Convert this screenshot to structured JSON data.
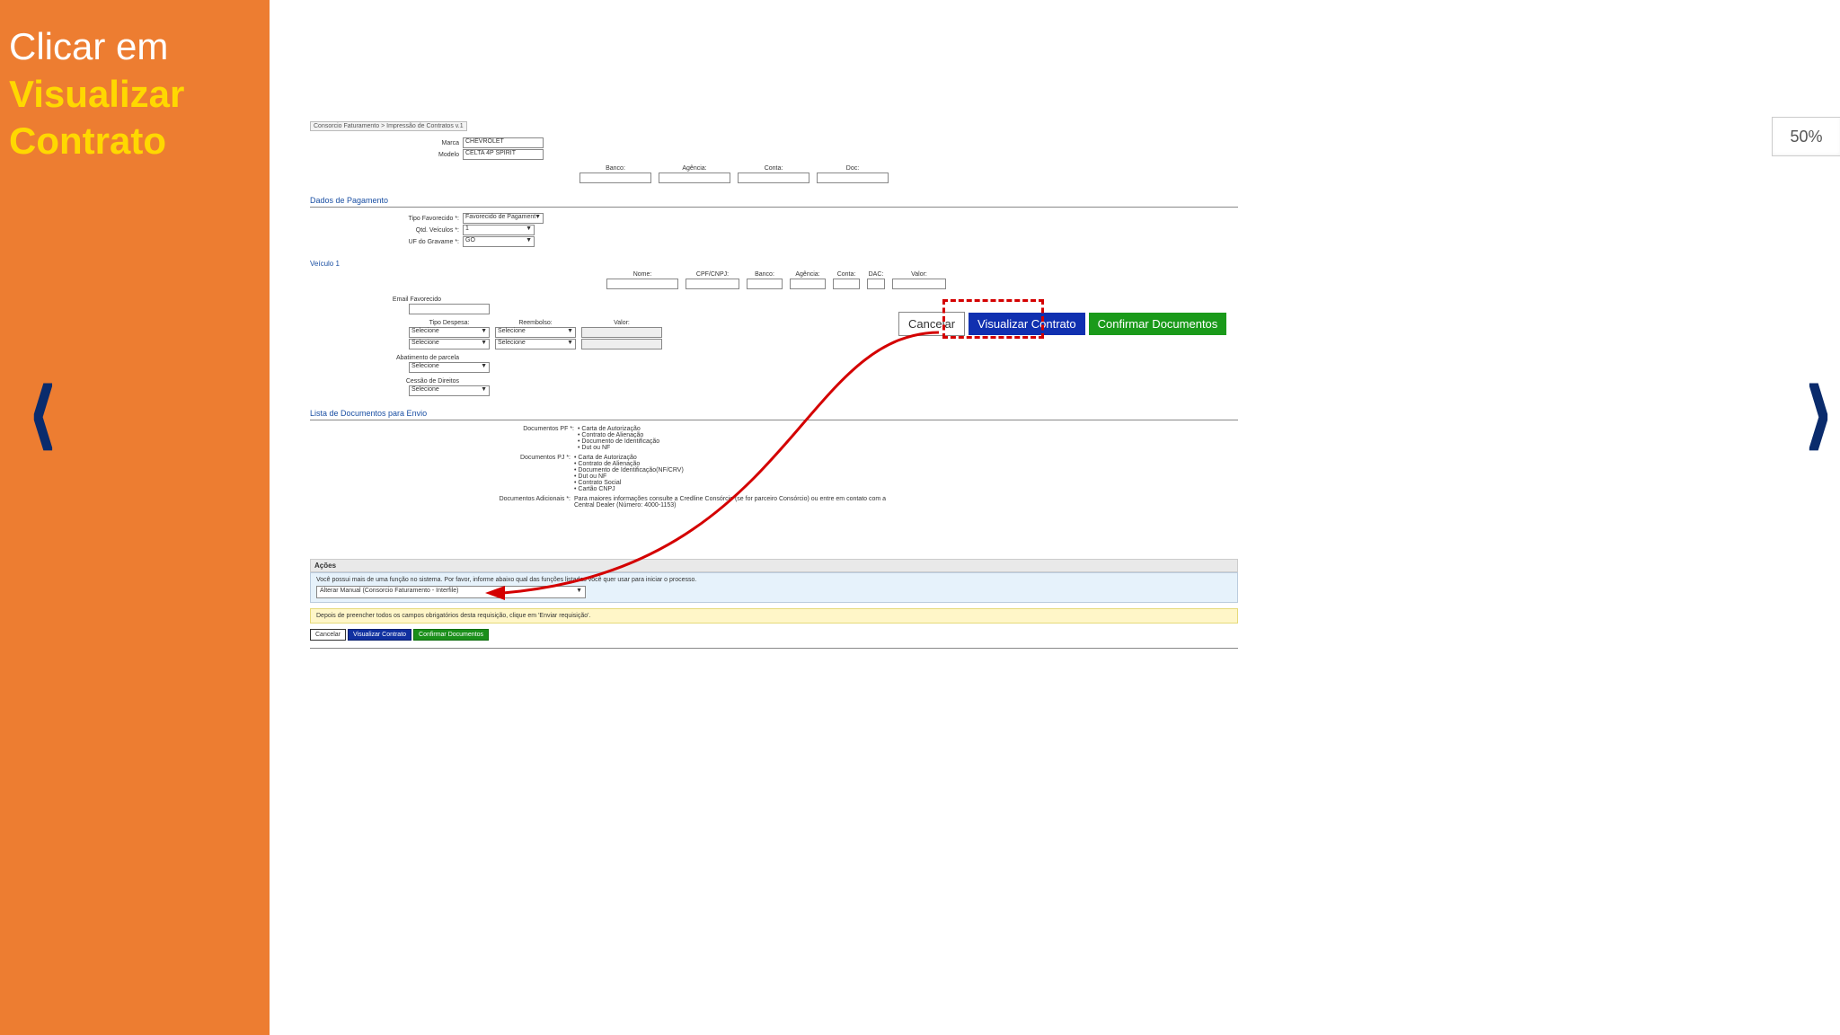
{
  "sidebar": {
    "line1": "Clicar em",
    "line2a": "Visualizar",
    "line2b": "Contrato"
  },
  "zoom": "50%",
  "breadcrumb": "Consorcio Faturamento > Impressão de Contratos v.1",
  "vehicle_top": {
    "marca_label": "Marca",
    "marca_value": "CHEVROLET",
    "modelo_label": "Modelo",
    "modelo_value": "CELTA 4P SPIRIT"
  },
  "bank_headers": {
    "banco": "Banco:",
    "agencia": "Agência:",
    "conta": "Conta:",
    "doc": "Doc:"
  },
  "sections": {
    "dados_pagamento": "Dados de Pagamento",
    "veiculo1": "Veículo 1",
    "lista_docs": "Lista de Documentos para Envio",
    "acoes": "Ações"
  },
  "pagamento": {
    "tipo_label": "Tipo Favorecido *:",
    "tipo_value": "Favorecido de Pagament",
    "qtd_label": "Qtd. Veículos *:",
    "qtd_value": "1",
    "uf_label": "UF do Gravame *:",
    "uf_value": "GO"
  },
  "veh_headers": {
    "nome": "Nome:",
    "cpf": "CPF/CNPJ:",
    "banco": "Banco:",
    "agencia": "Agência:",
    "conta": "Conta:",
    "dac": "DAC:",
    "valor": "Valor:"
  },
  "email_label": "Email Favorecido",
  "despesa": {
    "tipo_label": "Tipo Despesa:",
    "reemb_label": "Reembolso:",
    "valor_label": "Valor:",
    "selecione": "Selecione"
  },
  "abatimento": {
    "label": "Abatimento de parcela",
    "selecione": "Selecione"
  },
  "cessao": {
    "label": "Cessão de Direitos",
    "selecione": "Selecione"
  },
  "big_buttons": {
    "cancelar": "Cancelar",
    "visualizar": "Visualizar Contrato",
    "confirmar": "Confirmar Documentos"
  },
  "docs": {
    "pf_label": "Documentos PF *:",
    "pf_items": [
      "Carta de Autorização",
      "Contrato de Alienação",
      "Documento de Identificação",
      "Dut ou NF"
    ],
    "pj_label": "Documentos PJ *:",
    "pj_items": [
      "Carta de Autorização",
      "Contrato de Alienação",
      "Documento de Identificação(NF/CRV)",
      "Dut ou NF",
      "Contrato Social",
      "Cartão CNPJ"
    ],
    "adic_label": "Documentos Adicionais *:",
    "adic_text": "Para maiores informações consulte a Credline Consórcio (se for parceiro Consórcio) ou entre em contato com a Central Dealer (Número: 4000-1153)"
  },
  "acoes_box": {
    "info": "Você possui mais de uma função no sistema. Por favor, informe abaixo qual das funções listadas você quer usar para iniciar o processo.",
    "role": "Alterar Manual (Consorcio Faturamento - Interfile)",
    "yellow": "Depois de preencher todos os campos obrigatórios desta requisição, clique em 'Enviar requisição'.",
    "btn_cancel": "Cancelar",
    "btn_view": "Visualizar Contrato",
    "btn_conf": "Confirmar Documentos"
  }
}
